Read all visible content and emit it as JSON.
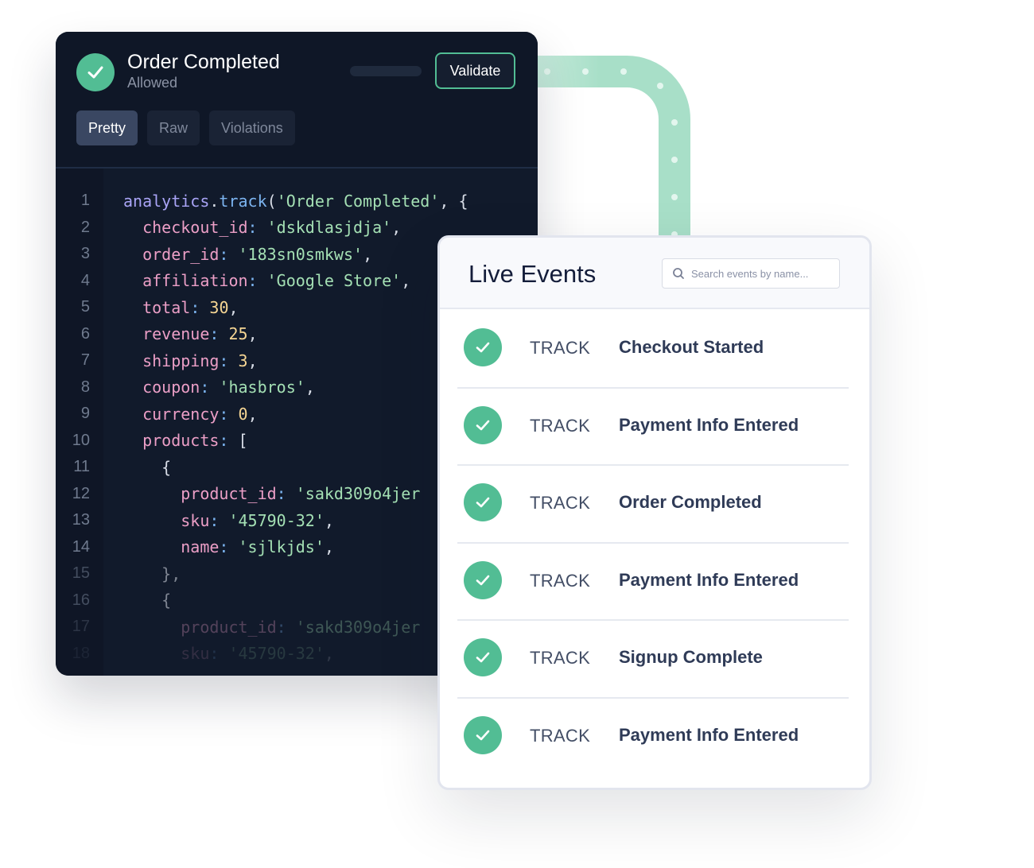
{
  "code_panel": {
    "event_title": "Order Completed",
    "event_status": "Allowed",
    "validate_label": "Validate",
    "tabs": [
      {
        "label": "Pretty",
        "active": true
      },
      {
        "label": "Raw",
        "active": false
      },
      {
        "label": "Violations",
        "active": false
      }
    ],
    "lines": [
      {
        "num": "1"
      },
      {
        "num": "2"
      },
      {
        "num": "3"
      },
      {
        "num": "4"
      },
      {
        "num": "5"
      },
      {
        "num": "6"
      },
      {
        "num": "7"
      },
      {
        "num": "8"
      },
      {
        "num": "9"
      },
      {
        "num": "10"
      },
      {
        "num": "11"
      },
      {
        "num": "12"
      },
      {
        "num": "13"
      },
      {
        "num": "14"
      },
      {
        "num": "15"
      },
      {
        "num": "16"
      },
      {
        "num": "17"
      },
      {
        "num": "18"
      }
    ],
    "code": {
      "l1": {
        "obj": "analytics",
        "dot": ".",
        "fn": "track",
        "open": "(",
        "str": "'Order Completed'",
        "rest": ", {"
      },
      "l2": {
        "key": "checkout_id",
        "val": "'dskdlasjdja'"
      },
      "l3": {
        "key": "order_id",
        "val": "'183sn0smkws'"
      },
      "l4": {
        "key": "affiliation",
        "val": "'Google Store'"
      },
      "l5": {
        "key": "total",
        "val": "30"
      },
      "l6": {
        "key": "revenue",
        "val": "25"
      },
      "l7": {
        "key": "shipping",
        "val": "3"
      },
      "l8": {
        "key": "coupon",
        "val": "'hasbros'"
      },
      "l9": {
        "key": "currency",
        "val": "0"
      },
      "l10": {
        "key": "products",
        "val": "["
      },
      "l11": {
        "val": "{"
      },
      "l12": {
        "key": "product_id",
        "val": "'sakd309o4jer"
      },
      "l13": {
        "key": "sku",
        "val": "'45790-32'"
      },
      "l14": {
        "key": "name",
        "val": "'sjlkjds'"
      },
      "l15": {
        "val": "},"
      },
      "l16": {
        "val": "{"
      },
      "l17": {
        "key": "product_id",
        "val": "'sakd309o4jer"
      },
      "l18": {
        "key": "sku",
        "val": "'45790-32'"
      }
    }
  },
  "live_events": {
    "title": "Live Events",
    "search_placeholder": "Search events by name...",
    "events": [
      {
        "type": "TRACK",
        "name": "Checkout Started",
        "status": "success"
      },
      {
        "type": "TRACK",
        "name": "Payment Info Entered",
        "status": "success"
      },
      {
        "type": "TRACK",
        "name": "Order Completed",
        "status": "success"
      },
      {
        "type": "TRACK",
        "name": "Payment Info Entered",
        "status": "success"
      },
      {
        "type": "TRACK",
        "name": "Signup Complete",
        "status": "success"
      },
      {
        "type": "TRACK",
        "name": "Payment Info Entered",
        "status": "success"
      }
    ]
  },
  "colors": {
    "accent_green": "#52bd94",
    "pipe_green": "#a8dfc8",
    "code_bg": "#111a2b"
  },
  "punct": {
    "colon": ": ",
    "comma": ","
  }
}
